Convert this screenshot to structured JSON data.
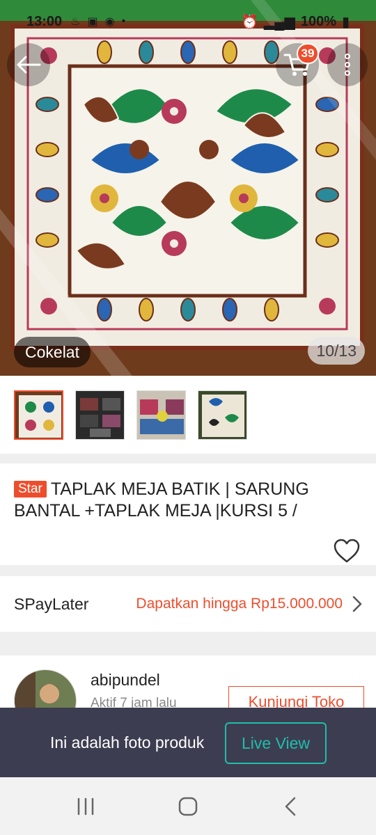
{
  "status_bar": {
    "time": "13:00",
    "battery": "100%",
    "accent": "#1a1a1a"
  },
  "header": {
    "cart_count": "39"
  },
  "gallery": {
    "variant": "Cokelat",
    "counter": "10/13"
  },
  "thumbnails": [
    {
      "name": "batik-tablecloth"
    },
    {
      "name": "folded-fabrics"
    },
    {
      "name": "sofa-set"
    },
    {
      "name": "batik-pattern"
    }
  ],
  "product": {
    "badge": "Star",
    "title": "TAPLAK MEJA BATIK | SARUNG BANTAL +TAPLAK MEJA |KURSI 5 /"
  },
  "spaylater": {
    "label": "SPayLater",
    "offer": "Dapatkan hingga Rp15.000.000"
  },
  "shop": {
    "name": "abipundel",
    "active": "Aktif 7 jam lalu",
    "visit_label": "Kunjungi Toko"
  },
  "banner": {
    "text": "Ini adalah foto produk",
    "live_label": "Live View"
  },
  "colors": {
    "brand": "#ee4d2d",
    "teal": "#1fbeaa",
    "banner_bg": "#3d3d51"
  }
}
